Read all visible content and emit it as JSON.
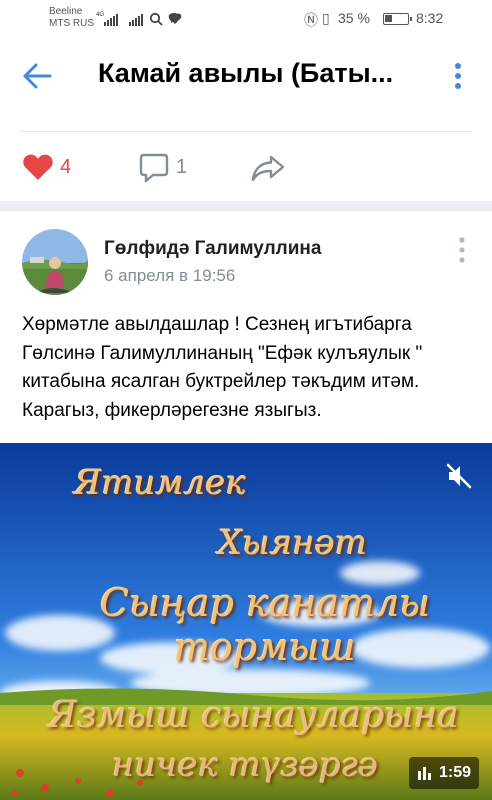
{
  "status_bar": {
    "carrier_1": "Beeline",
    "carrier_2": "MTS RUS",
    "network_small": "4G",
    "battery_text": "35 %",
    "battery_level": 0.35,
    "time": "8:32"
  },
  "header": {
    "title": "Камай авылы (Баты..."
  },
  "previous_post_actions": {
    "like_count": "4",
    "comment_count": "1"
  },
  "post": {
    "author": "Гөлфидә Галимуллина",
    "date": "6 апреля в 19:56",
    "text": "Хөрмәтле авылдашлар ! Сезнең игътибарга Гөлсинә Галимуллинаның \"Ефәк кулъяулык \" китабына ясалган буктрейлер тәкъдим итәм. Карагыз, фикерләрегезне языгыз.",
    "video": {
      "line_1": "Ятимлек",
      "line_2": "Хыянәт",
      "line_3": "Сыңар канатлы",
      "line_4": "тормыш",
      "line_5": "Язмыш сынауларына",
      "line_6": "ничек түзәргә",
      "duration": "1:59"
    }
  },
  "colors": {
    "accent": "#3f8ae0",
    "like": "#e64646",
    "secondary": "#818c99"
  }
}
